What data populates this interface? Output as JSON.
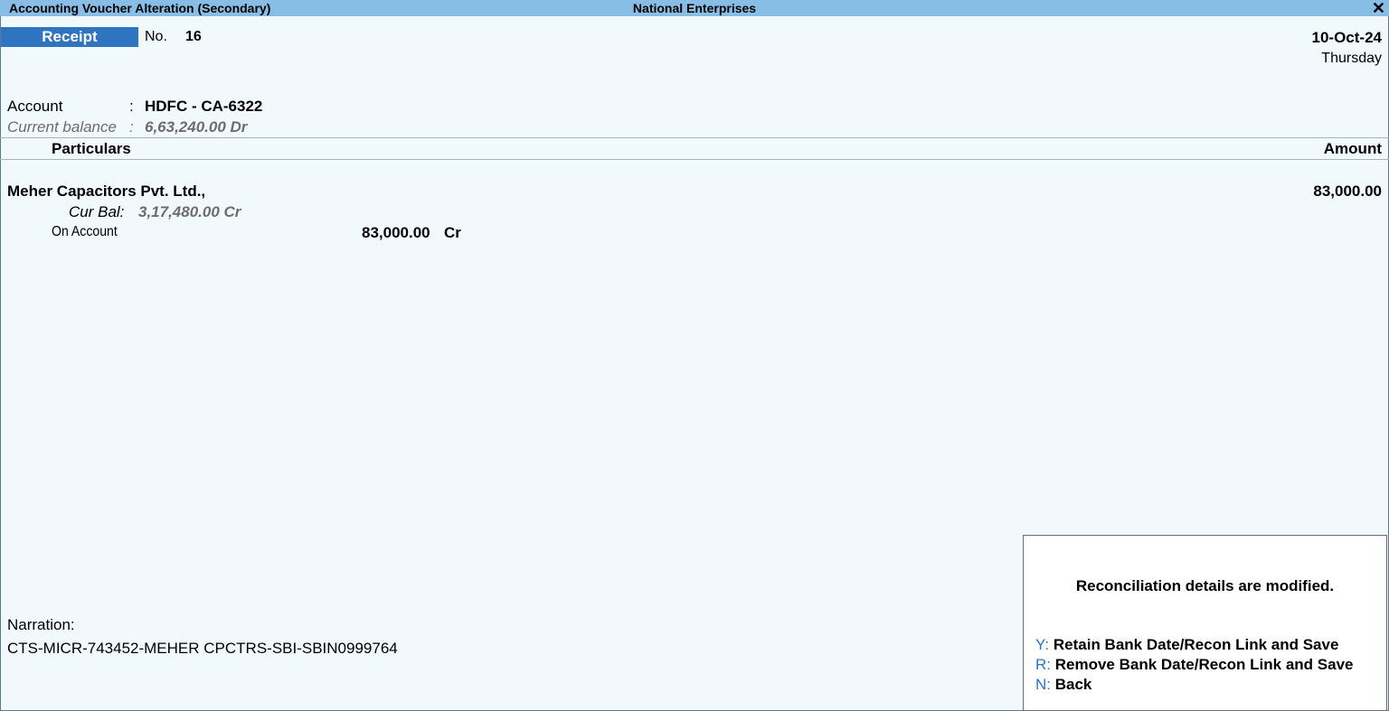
{
  "titlebar": {
    "title": "Accounting Voucher Alteration (Secondary)",
    "company": "National Enterprises",
    "close_glyph": "✕"
  },
  "voucher": {
    "type": "Receipt",
    "no_label": "No.",
    "no_value": "16",
    "date": "10-Oct-24",
    "day": "Thursday"
  },
  "account": {
    "label": "Account",
    "colon": ":",
    "value": "HDFC - CA-6322",
    "balance_label": "Current balance",
    "balance_colon": ":",
    "balance_value": "6,63,240.00 Dr"
  },
  "columns": {
    "particulars": "Particulars",
    "amount": "Amount"
  },
  "entries": [
    {
      "party": "Meher Capacitors Pvt. Ltd.,",
      "amount": "83,000.00",
      "cur_bal_label": "Cur Bal:",
      "cur_bal_value": "3,17,480.00 Cr",
      "bill_ref": "On Account",
      "bill_amount": "83,000.00",
      "bill_drcr": "Cr"
    }
  ],
  "narration": {
    "label": "Narration:",
    "value": "CTS-MICR-743452-MEHER CPCTRS-SBI-SBIN0999764"
  },
  "dialog": {
    "message": "Reconciliation details are modified.",
    "options": [
      {
        "key": "Y",
        "sep": ":",
        "label": "Retain Bank Date/Recon Link and Save"
      },
      {
        "key": "R",
        "sep": ":",
        "label": "Remove Bank Date/Recon Link and Save"
      },
      {
        "key": "N",
        "sep": ":",
        "label": "Back"
      }
    ]
  },
  "colors": {
    "titlebar_bg": "#88bde6",
    "voucher_type_bg": "#2f74c0",
    "page_bg": "#f2f9fd",
    "option_key": "#2f74c0",
    "muted_text": "#6d6d6d"
  }
}
